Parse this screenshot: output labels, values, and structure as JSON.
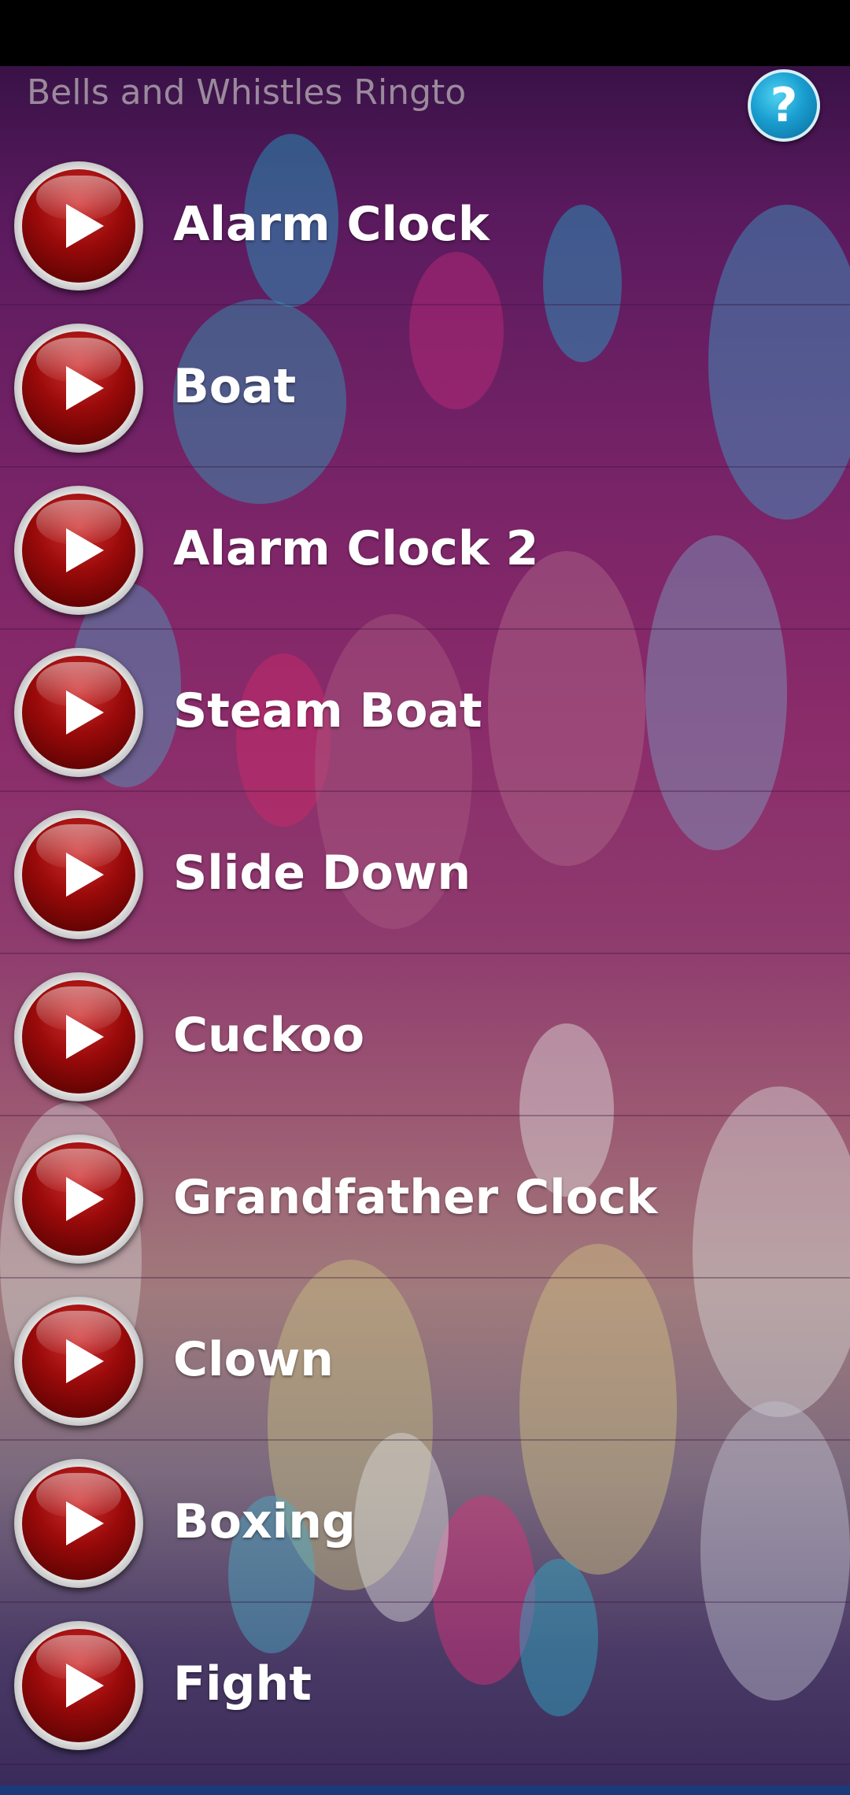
{
  "app": {
    "title": "Bells and Whistles Ringto",
    "help_icon": "question-mark-icon"
  },
  "ringtones": [
    {
      "label": "Alarm Clock"
    },
    {
      "label": "Boat"
    },
    {
      "label": "Alarm Clock 2"
    },
    {
      "label": "Steam Boat"
    },
    {
      "label": "Slide Down"
    },
    {
      "label": "Cuckoo"
    },
    {
      "label": "Grandfather Clock"
    },
    {
      "label": "Clown"
    },
    {
      "label": "Boxing"
    },
    {
      "label": "Fight"
    }
  ],
  "colors": {
    "background_top": "#5a1a5e",
    "background_mid": "#8e3a6e",
    "play_button": "#9a0a0a",
    "help_button": "#1a9ed0"
  }
}
